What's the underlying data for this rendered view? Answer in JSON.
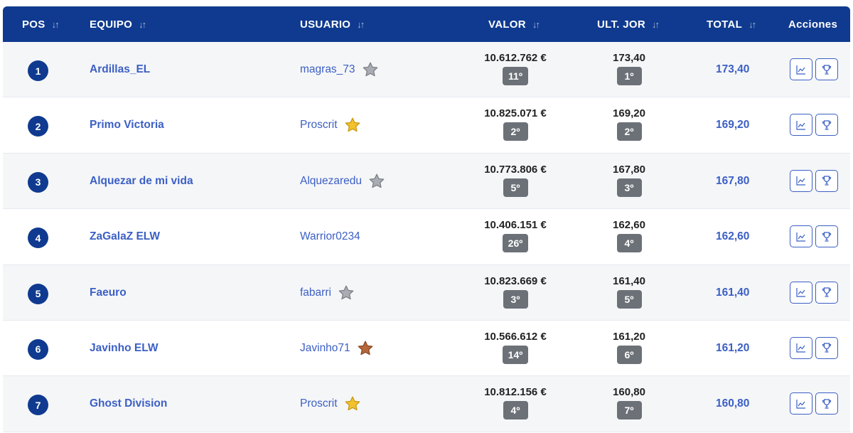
{
  "headers": {
    "pos": "POS",
    "equipo": "EQUIPO",
    "usuario": "USUARIO",
    "valor": "VALOR",
    "ult_jor": "ULT. JOR",
    "total": "TOTAL",
    "acciones": "Acciones",
    "sort_icon": "sort-arrows-icon"
  },
  "colors": {
    "header_bg": "#0f3a8f",
    "link": "#3b5fc4",
    "rank_badge": "#6c7178",
    "star_gold": "#f2c12e",
    "star_silver": "#a9adb3",
    "star_bronze": "#b7683a"
  },
  "rows": [
    {
      "pos": "1",
      "team": "Ardillas_EL",
      "user": "magras_73",
      "star": "silver",
      "valor": "10.612.762 €",
      "valor_rank": "11º",
      "ult_jor": "173,40",
      "ult_rank": "1º",
      "total": "173,40"
    },
    {
      "pos": "2",
      "team": "Primo Victoria",
      "user": "Proscrit",
      "star": "gold",
      "valor": "10.825.071 €",
      "valor_rank": "2º",
      "ult_jor": "169,20",
      "ult_rank": "2º",
      "total": "169,20"
    },
    {
      "pos": "3",
      "team": "Alquezar de mi vida",
      "user": "Alquezaredu",
      "star": "silver",
      "valor": "10.773.806 €",
      "valor_rank": "5º",
      "ult_jor": "167,80",
      "ult_rank": "3º",
      "total": "167,80"
    },
    {
      "pos": "4",
      "team": "ZaGalaZ ELW",
      "user": "Warrior0234",
      "star": "none",
      "valor": "10.406.151 €",
      "valor_rank": "26º",
      "ult_jor": "162,60",
      "ult_rank": "4º",
      "total": "162,60"
    },
    {
      "pos": "5",
      "team": "Faeuro",
      "user": "fabarri",
      "star": "silver",
      "valor": "10.823.669 €",
      "valor_rank": "3º",
      "ult_jor": "161,40",
      "ult_rank": "5º",
      "total": "161,40"
    },
    {
      "pos": "6",
      "team": "Javinho ELW",
      "user": "Javinho71",
      "star": "bronze",
      "valor": "10.566.612 €",
      "valor_rank": "14º",
      "ult_jor": "161,20",
      "ult_rank": "6º",
      "total": "161,20"
    },
    {
      "pos": "7",
      "team": "Ghost Division",
      "user": "Proscrit",
      "star": "gold",
      "valor": "10.812.156 €",
      "valor_rank": "4º",
      "ult_jor": "160,80",
      "ult_rank": "7º",
      "total": "160,80"
    }
  ],
  "actions": {
    "chart_icon": "line-chart-icon",
    "trophy_icon": "trophy-icon"
  }
}
